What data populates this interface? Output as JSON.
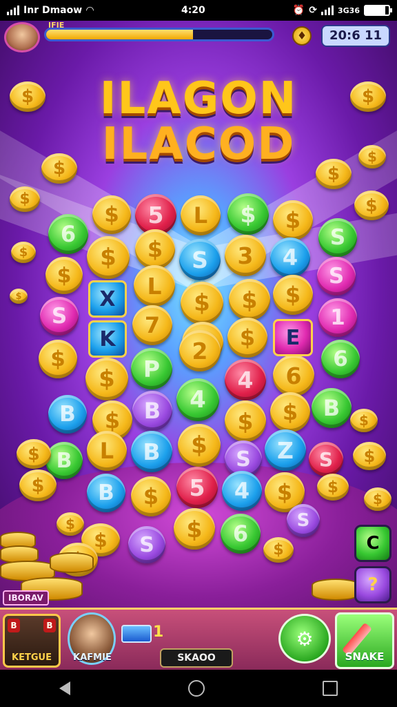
{
  "status_bar": {
    "carrier": "Inr Dmaow",
    "time": "4:20",
    "right_text": "3G36"
  },
  "hud_top": {
    "level_label": "IFIE",
    "progress": 0.65,
    "score": "20:6 11"
  },
  "title": {
    "line1": "ILAGON",
    "line2": "ILACOD"
  },
  "board": {
    "coins": [
      {
        "color": "gold",
        "label": "$"
      },
      {
        "color": "red",
        "label": "5"
      },
      {
        "color": "gold",
        "label": "L"
      },
      {
        "color": "green",
        "label": "$"
      },
      {
        "color": "gold",
        "label": "$"
      },
      {
        "color": "green",
        "label": "6"
      },
      {
        "color": "gold",
        "label": "$"
      },
      {
        "color": "gold",
        "label": "$"
      },
      {
        "color": "blue",
        "label": "S"
      },
      {
        "color": "gold",
        "label": "3"
      },
      {
        "color": "blue",
        "label": "4"
      },
      {
        "color": "green",
        "label": "S"
      },
      {
        "color": "gold",
        "label": "$"
      },
      {
        "color": "gold",
        "label": "L"
      },
      {
        "color": "gold",
        "label": "$"
      },
      {
        "color": "gold",
        "label": "$"
      },
      {
        "color": "gold",
        "label": "$"
      },
      {
        "color": "pink",
        "label": "S"
      },
      {
        "color": "pink",
        "label": "S"
      },
      {
        "color": "gold",
        "label": "7"
      },
      {
        "color": "gold",
        "label": "$"
      },
      {
        "color": "gold",
        "label": "$"
      },
      {
        "color": "pink",
        "label": "1"
      },
      {
        "color": "gold",
        "label": "$"
      },
      {
        "color": "gold",
        "label": "$"
      },
      {
        "color": "green",
        "label": "P"
      },
      {
        "color": "gold",
        "label": "2"
      },
      {
        "color": "red",
        "label": "4"
      },
      {
        "color": "gold",
        "label": "6"
      },
      {
        "color": "green",
        "label": "6"
      },
      {
        "color": "blue",
        "label": "B"
      },
      {
        "color": "gold",
        "label": "$"
      },
      {
        "color": "purple",
        "label": "B"
      },
      {
        "color": "green",
        "label": "4"
      },
      {
        "color": "gold",
        "label": "$"
      },
      {
        "color": "gold",
        "label": "$"
      },
      {
        "color": "green",
        "label": "B"
      },
      {
        "color": "green",
        "label": "B"
      },
      {
        "color": "gold",
        "label": "L"
      },
      {
        "color": "blue",
        "label": "B"
      },
      {
        "color": "gold",
        "label": "$"
      },
      {
        "color": "purple",
        "label": "S"
      },
      {
        "color": "blue",
        "label": "Z"
      },
      {
        "color": "red",
        "label": "S"
      },
      {
        "color": "blue",
        "label": "B"
      },
      {
        "color": "gold",
        "label": "$"
      },
      {
        "color": "red",
        "label": "5"
      },
      {
        "color": "blue",
        "label": "4"
      },
      {
        "color": "gold",
        "label": "$"
      },
      {
        "color": "gold",
        "label": "$"
      },
      {
        "color": "green",
        "label": "6"
      },
      {
        "color": "purple",
        "label": "S"
      },
      {
        "color": "purple",
        "label": "S"
      }
    ],
    "tiles": [
      "X",
      "K",
      "E"
    ]
  },
  "combo_label": "IBORAV",
  "side_buttons": [
    "C",
    "?"
  ],
  "hud_bottom": {
    "char_card_label": "KETGUE",
    "badge_left": "B",
    "badge_right": "B",
    "char2_label": "KAFMIE",
    "card_count": "1",
    "center_button": "SKAOO",
    "shake_label": "SNAKE"
  },
  "colors": {
    "gold": "#f5b81a",
    "green": "#38c832",
    "red": "#e0204a",
    "blue": "#1ca0ec",
    "pink": "#e02ab0",
    "purple": "#9a4ae0",
    "accent": "#ffc61a"
  }
}
